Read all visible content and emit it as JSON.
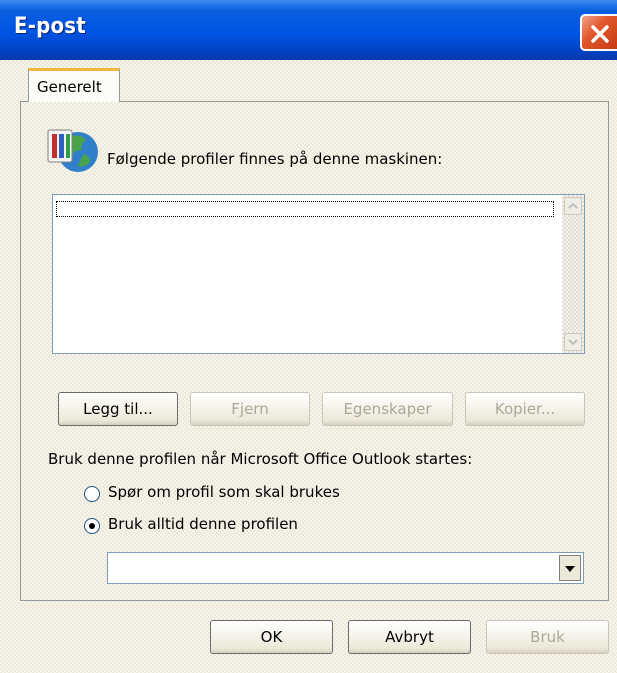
{
  "window": {
    "title": "E-post"
  },
  "tabs": [
    {
      "label": "Generelt"
    }
  ],
  "profiles": {
    "heading": "Følgende profiler finnes på denne maskinen:",
    "items": []
  },
  "buttons": {
    "add": "Legg til...",
    "remove": "Fjern",
    "properties": "Egenskaper",
    "copy": "Kopier..."
  },
  "startup": {
    "label": "Bruk denne profilen når Microsoft Office Outlook startes:",
    "option_prompt": "Spør om profil som skal brukes",
    "option_always": "Bruk alltid denne profilen",
    "selected_option": "always",
    "profile_value": ""
  },
  "footer": {
    "ok": "OK",
    "cancel": "Avbryt",
    "apply": "Bruk"
  }
}
